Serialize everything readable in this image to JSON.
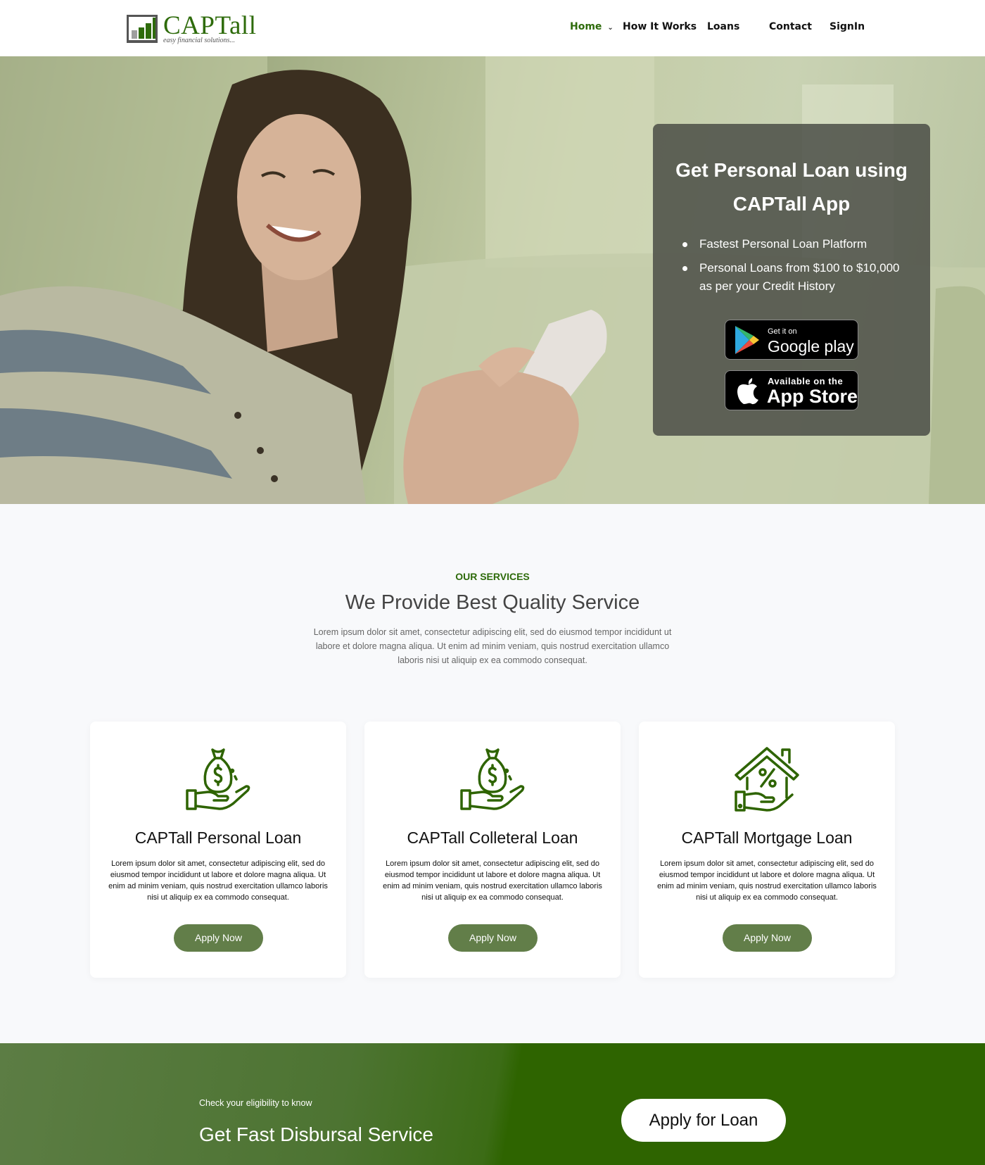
{
  "brand": {
    "name": "CAPTall",
    "tagline": "easy financial solutions...",
    "color": "#2e6b0b"
  },
  "nav": {
    "items": [
      {
        "label": "Home",
        "active": true
      },
      {
        "label": "How It Works"
      },
      {
        "label": "Loans"
      },
      {
        "label": "Contact"
      },
      {
        "label": "SignIn"
      }
    ]
  },
  "hero": {
    "title_line1": "Get Personal Loan using",
    "title_line2": "CAPTall App",
    "bullets": [
      "Fastest Personal Loan Platform",
      "Personal Loans from $100 to $10,000 as per your Credit History"
    ],
    "google_play": {
      "small": "Get it on",
      "big": "Google play"
    },
    "app_store": {
      "small": "Available on the",
      "big": "App Store"
    }
  },
  "services": {
    "kicker": "OUR SERVICES",
    "title": "We Provide Best Quality Service",
    "description": "Lorem ipsum dolor sit amet, consectetur adipiscing elit, sed do eiusmod tempor incididunt ut labore et dolore magna aliqua. Ut enim ad minim veniam, quis nostrud exercitation ullamco laboris nisi ut aliquip ex ea commodo consequat.",
    "cards": [
      {
        "icon": "money-bag-hand-icon",
        "title": "CAPTall Personal Loan",
        "text": "Lorem ipsum dolor sit amet, consectetur adipiscing elit, sed do eiusmod tempor incididunt ut labore et dolore magna aliqua. Ut enim ad minim veniam, quis nostrud exercitation ullamco laboris nisi ut aliquip ex ea commodo consequat.",
        "button": "Apply Now"
      },
      {
        "icon": "money-bag-hand-icon",
        "title": "CAPTall Colleteral Loan",
        "text": "Lorem ipsum dolor sit amet, consectetur adipiscing elit, sed do eiusmod tempor incididunt ut labore et dolore magna aliqua. Ut enim ad minim veniam, quis nostrud exercitation ullamco laboris nisi ut aliquip ex ea commodo consequat.",
        "button": "Apply Now"
      },
      {
        "icon": "house-percent-hand-icon",
        "title": "CAPTall Mortgage Loan",
        "text": "Lorem ipsum dolor sit amet, consectetur adipiscing elit, sed do eiusmod tempor incididunt ut labore et dolore magna aliqua. Ut enim ad minim veniam, quis nostrud exercitation ullamco laboris nisi ut aliquip ex ea commodo consequat.",
        "button": "Apply Now"
      }
    ]
  },
  "cta": {
    "kicker": "Check your eligibility to know",
    "title": "Get Fast Disbursal Service",
    "button": "Apply for Loan"
  },
  "colors": {
    "accent": "#2e6b0b",
    "button": "#627e49",
    "cta_bg": "#2e6400"
  }
}
